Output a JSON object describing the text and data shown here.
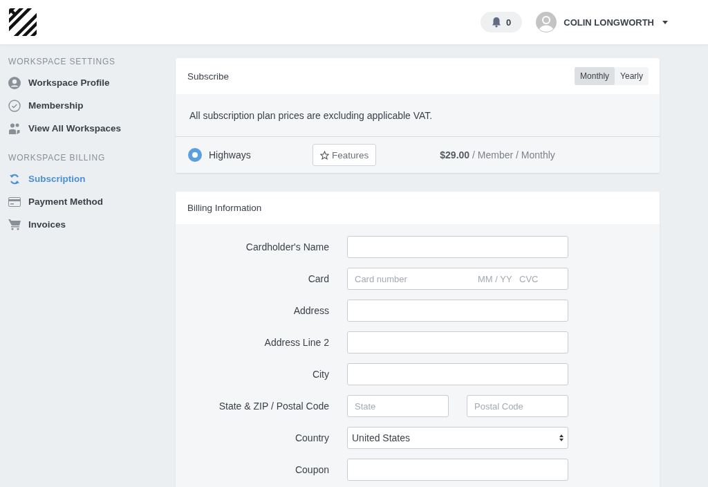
{
  "header": {
    "notifications": {
      "count": "0"
    },
    "user": {
      "name": "COLIN LONGWORTH"
    }
  },
  "sidebar": {
    "sections": [
      {
        "heading": "WORKSPACE SETTINGS",
        "items": [
          {
            "label": "Workspace Profile",
            "selected": false
          },
          {
            "label": "Membership",
            "selected": false
          },
          {
            "label": "View All Workspaces",
            "selected": false
          }
        ]
      },
      {
        "heading": "WORKSPACE BILLING",
        "items": [
          {
            "label": "Subscription",
            "selected": true
          },
          {
            "label": "Payment Method",
            "selected": false
          },
          {
            "label": "Invoices",
            "selected": false
          }
        ]
      }
    ]
  },
  "subscribe": {
    "title": "Subscribe",
    "periods": [
      {
        "label": "Monthly",
        "selected": true
      },
      {
        "label": "Yearly",
        "selected": false
      }
    ],
    "notice": "All subscription plan prices are excluding applicable VAT.",
    "plans": [
      {
        "name": "Highways",
        "selected": true,
        "features": "Features",
        "price": "$29.00",
        "unit": "/ Member / Monthly"
      }
    ]
  },
  "billing": {
    "title": "Billing Information",
    "fields": [
      {
        "kind": "text",
        "label": "Cardholder's Name"
      },
      {
        "kind": "card",
        "label": "Card",
        "placeholders": [
          "Card number",
          "MM / YY",
          "CVC"
        ]
      },
      {
        "kind": "text",
        "label": "Address"
      },
      {
        "kind": "text",
        "label": "Address Line 2"
      },
      {
        "kind": "text",
        "label": "City"
      },
      {
        "kind": "pair",
        "label": "State & ZIP / Postal Code",
        "placeholders": [
          "State",
          "Postal Code"
        ]
      },
      {
        "kind": "select",
        "label": "Country",
        "value": "United States"
      },
      {
        "kind": "text",
        "label": "Coupon"
      }
    ]
  }
}
